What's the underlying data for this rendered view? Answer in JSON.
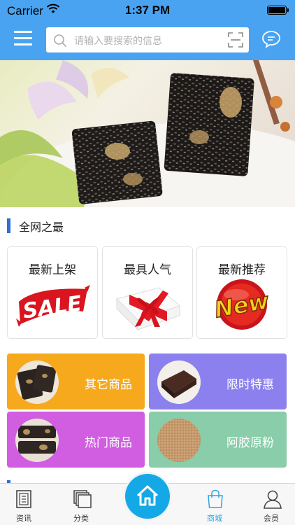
{
  "status_bar": {
    "carrier": "Carrier",
    "time": "1:37 PM"
  },
  "header": {
    "menu_icon": "hamburger-menu-icon",
    "search_placeholder": "请输入要搜索的信息",
    "scan_icon": "scan-icon",
    "message_icon": "chat-bubble-icon"
  },
  "banner": {
    "slide_count": 2,
    "active_slide": 2
  },
  "section": {
    "title": "全网之最"
  },
  "feature_cards": [
    {
      "label": "最新上架",
      "image_text": "SALE"
    },
    {
      "label": "最具人气",
      "image": "gift-box"
    },
    {
      "label": "最新推荐",
      "image_text": "New"
    }
  ],
  "category_tiles": [
    {
      "label": "其它商品",
      "color": "#f6a91c"
    },
    {
      "label": "限时特惠",
      "color": "#8c80ee"
    },
    {
      "label": "热门商品",
      "color": "#d15ee0"
    },
    {
      "label": "阿胶原粉",
      "color": "#89cdaa"
    }
  ],
  "tabbar": {
    "items": [
      {
        "label": "资讯",
        "icon": "news-icon"
      },
      {
        "label": "分类",
        "icon": "category-icon"
      },
      {
        "label": "",
        "icon": "home-icon"
      },
      {
        "label": "商城",
        "icon": "shopping-bag-icon"
      },
      {
        "label": "会员",
        "icon": "user-icon"
      }
    ],
    "active_label": "商城",
    "active_color": "#2fa3e6"
  },
  "colors": {
    "nav": "#4aa3f0",
    "accent": "#2f6ed6",
    "home_button": "#14a9e6"
  }
}
